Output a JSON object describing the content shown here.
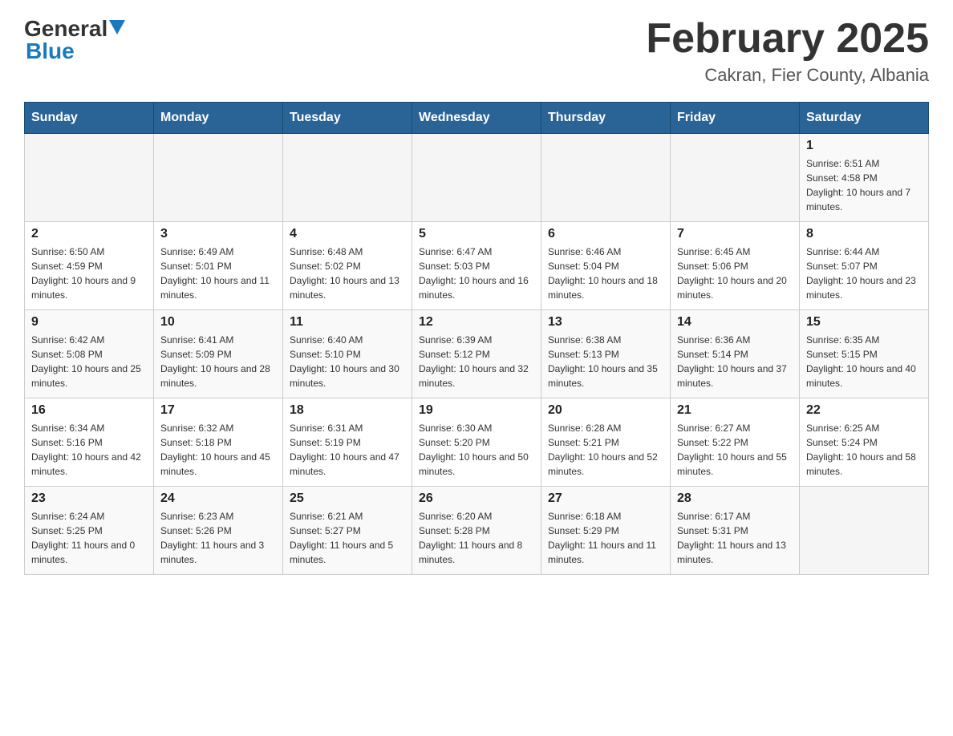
{
  "logo": {
    "general": "General",
    "blue": "Blue",
    "triangle": "▼"
  },
  "header": {
    "title": "February 2025",
    "location": "Cakran, Fier County, Albania"
  },
  "weekdays": [
    "Sunday",
    "Monday",
    "Tuesday",
    "Wednesday",
    "Thursday",
    "Friday",
    "Saturday"
  ],
  "weeks": [
    [
      {
        "day": "",
        "info": ""
      },
      {
        "day": "",
        "info": ""
      },
      {
        "day": "",
        "info": ""
      },
      {
        "day": "",
        "info": ""
      },
      {
        "day": "",
        "info": ""
      },
      {
        "day": "",
        "info": ""
      },
      {
        "day": "1",
        "info": "Sunrise: 6:51 AM\nSunset: 4:58 PM\nDaylight: 10 hours and 7 minutes."
      }
    ],
    [
      {
        "day": "2",
        "info": "Sunrise: 6:50 AM\nSunset: 4:59 PM\nDaylight: 10 hours and 9 minutes."
      },
      {
        "day": "3",
        "info": "Sunrise: 6:49 AM\nSunset: 5:01 PM\nDaylight: 10 hours and 11 minutes."
      },
      {
        "day": "4",
        "info": "Sunrise: 6:48 AM\nSunset: 5:02 PM\nDaylight: 10 hours and 13 minutes."
      },
      {
        "day": "5",
        "info": "Sunrise: 6:47 AM\nSunset: 5:03 PM\nDaylight: 10 hours and 16 minutes."
      },
      {
        "day": "6",
        "info": "Sunrise: 6:46 AM\nSunset: 5:04 PM\nDaylight: 10 hours and 18 minutes."
      },
      {
        "day": "7",
        "info": "Sunrise: 6:45 AM\nSunset: 5:06 PM\nDaylight: 10 hours and 20 minutes."
      },
      {
        "day": "8",
        "info": "Sunrise: 6:44 AM\nSunset: 5:07 PM\nDaylight: 10 hours and 23 minutes."
      }
    ],
    [
      {
        "day": "9",
        "info": "Sunrise: 6:42 AM\nSunset: 5:08 PM\nDaylight: 10 hours and 25 minutes."
      },
      {
        "day": "10",
        "info": "Sunrise: 6:41 AM\nSunset: 5:09 PM\nDaylight: 10 hours and 28 minutes."
      },
      {
        "day": "11",
        "info": "Sunrise: 6:40 AM\nSunset: 5:10 PM\nDaylight: 10 hours and 30 minutes."
      },
      {
        "day": "12",
        "info": "Sunrise: 6:39 AM\nSunset: 5:12 PM\nDaylight: 10 hours and 32 minutes."
      },
      {
        "day": "13",
        "info": "Sunrise: 6:38 AM\nSunset: 5:13 PM\nDaylight: 10 hours and 35 minutes."
      },
      {
        "day": "14",
        "info": "Sunrise: 6:36 AM\nSunset: 5:14 PM\nDaylight: 10 hours and 37 minutes."
      },
      {
        "day": "15",
        "info": "Sunrise: 6:35 AM\nSunset: 5:15 PM\nDaylight: 10 hours and 40 minutes."
      }
    ],
    [
      {
        "day": "16",
        "info": "Sunrise: 6:34 AM\nSunset: 5:16 PM\nDaylight: 10 hours and 42 minutes."
      },
      {
        "day": "17",
        "info": "Sunrise: 6:32 AM\nSunset: 5:18 PM\nDaylight: 10 hours and 45 minutes."
      },
      {
        "day": "18",
        "info": "Sunrise: 6:31 AM\nSunset: 5:19 PM\nDaylight: 10 hours and 47 minutes."
      },
      {
        "day": "19",
        "info": "Sunrise: 6:30 AM\nSunset: 5:20 PM\nDaylight: 10 hours and 50 minutes."
      },
      {
        "day": "20",
        "info": "Sunrise: 6:28 AM\nSunset: 5:21 PM\nDaylight: 10 hours and 52 minutes."
      },
      {
        "day": "21",
        "info": "Sunrise: 6:27 AM\nSunset: 5:22 PM\nDaylight: 10 hours and 55 minutes."
      },
      {
        "day": "22",
        "info": "Sunrise: 6:25 AM\nSunset: 5:24 PM\nDaylight: 10 hours and 58 minutes."
      }
    ],
    [
      {
        "day": "23",
        "info": "Sunrise: 6:24 AM\nSunset: 5:25 PM\nDaylight: 11 hours and 0 minutes."
      },
      {
        "day": "24",
        "info": "Sunrise: 6:23 AM\nSunset: 5:26 PM\nDaylight: 11 hours and 3 minutes."
      },
      {
        "day": "25",
        "info": "Sunrise: 6:21 AM\nSunset: 5:27 PM\nDaylight: 11 hours and 5 minutes."
      },
      {
        "day": "26",
        "info": "Sunrise: 6:20 AM\nSunset: 5:28 PM\nDaylight: 11 hours and 8 minutes."
      },
      {
        "day": "27",
        "info": "Sunrise: 6:18 AM\nSunset: 5:29 PM\nDaylight: 11 hours and 11 minutes."
      },
      {
        "day": "28",
        "info": "Sunrise: 6:17 AM\nSunset: 5:31 PM\nDaylight: 11 hours and 13 minutes."
      },
      {
        "day": "",
        "info": ""
      }
    ]
  ]
}
